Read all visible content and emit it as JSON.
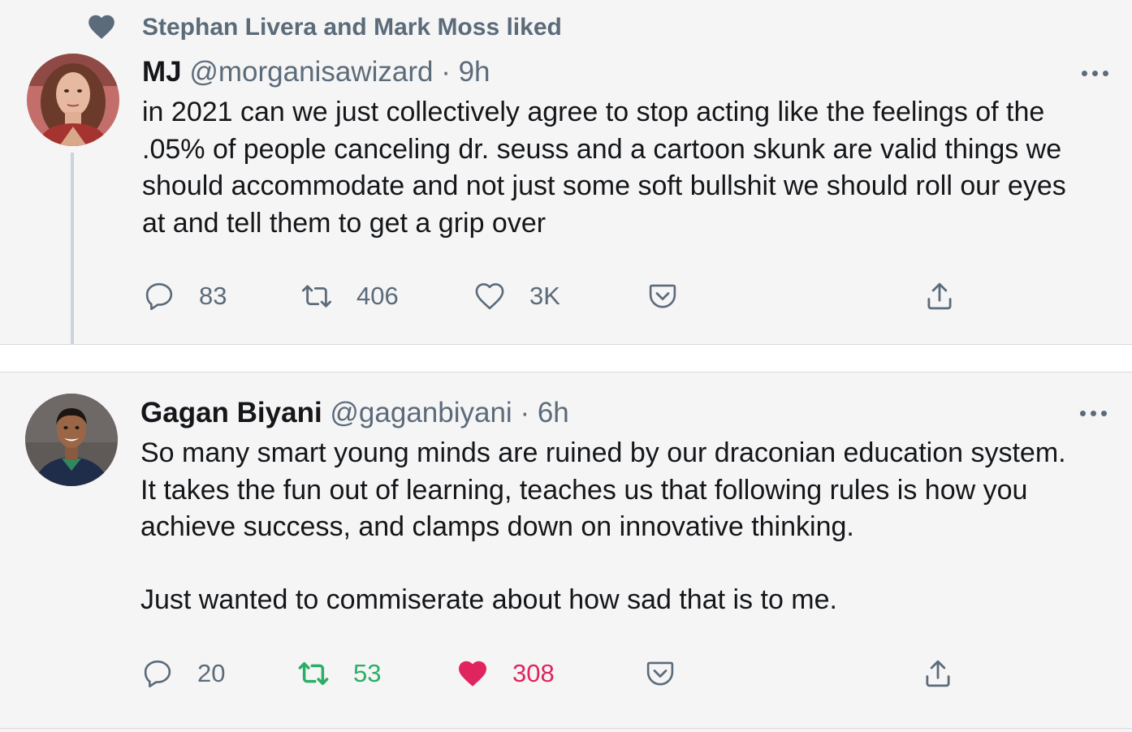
{
  "tweets": [
    {
      "social_context": "Stephan Livera and Mark Moss liked",
      "name": "MJ",
      "handle": "@morganisawizard",
      "separator": "·",
      "time": "9h",
      "text_lines": [
        "in 2021 can we just collectively agree to stop acting like the feelings of the",
        ".05% of people canceling dr. seuss and a cartoon skunk are valid things we",
        "should accommodate and not just some soft bullshit we should roll our eyes",
        "at and tell them to get a grip over"
      ],
      "replies": "83",
      "retweets": "406",
      "likes": "3K",
      "liked": false,
      "retweeted": false
    },
    {
      "name": "Gagan Biyani",
      "handle": "@gaganbiyani",
      "separator": "·",
      "time": "6h",
      "text_lines": [
        "So many smart young minds are ruined by our draconian education system.",
        "It takes the fun out of learning, teaches us that following rules is how you",
        "achieve success, and clamps down on innovative thinking."
      ],
      "text_lines_2": [
        "Just wanted to commiserate about how sad that is to me."
      ],
      "replies": "20",
      "retweets": "53",
      "likes": "308",
      "liked": true,
      "retweeted": true
    }
  ],
  "icons": {
    "social": "heart-icon",
    "reply": "reply-icon",
    "retweet": "retweet-icon",
    "like": "heart-outline-icon",
    "liked": "heart-filled-icon",
    "pocket": "pocket-icon",
    "share": "share-icon",
    "more": "more-icon"
  },
  "colors": {
    "muted": "#5c6b7a",
    "text": "#141619",
    "retweet_active": "#2bae66",
    "like_active": "#e0245e",
    "thread_line": "#c9d4de"
  }
}
